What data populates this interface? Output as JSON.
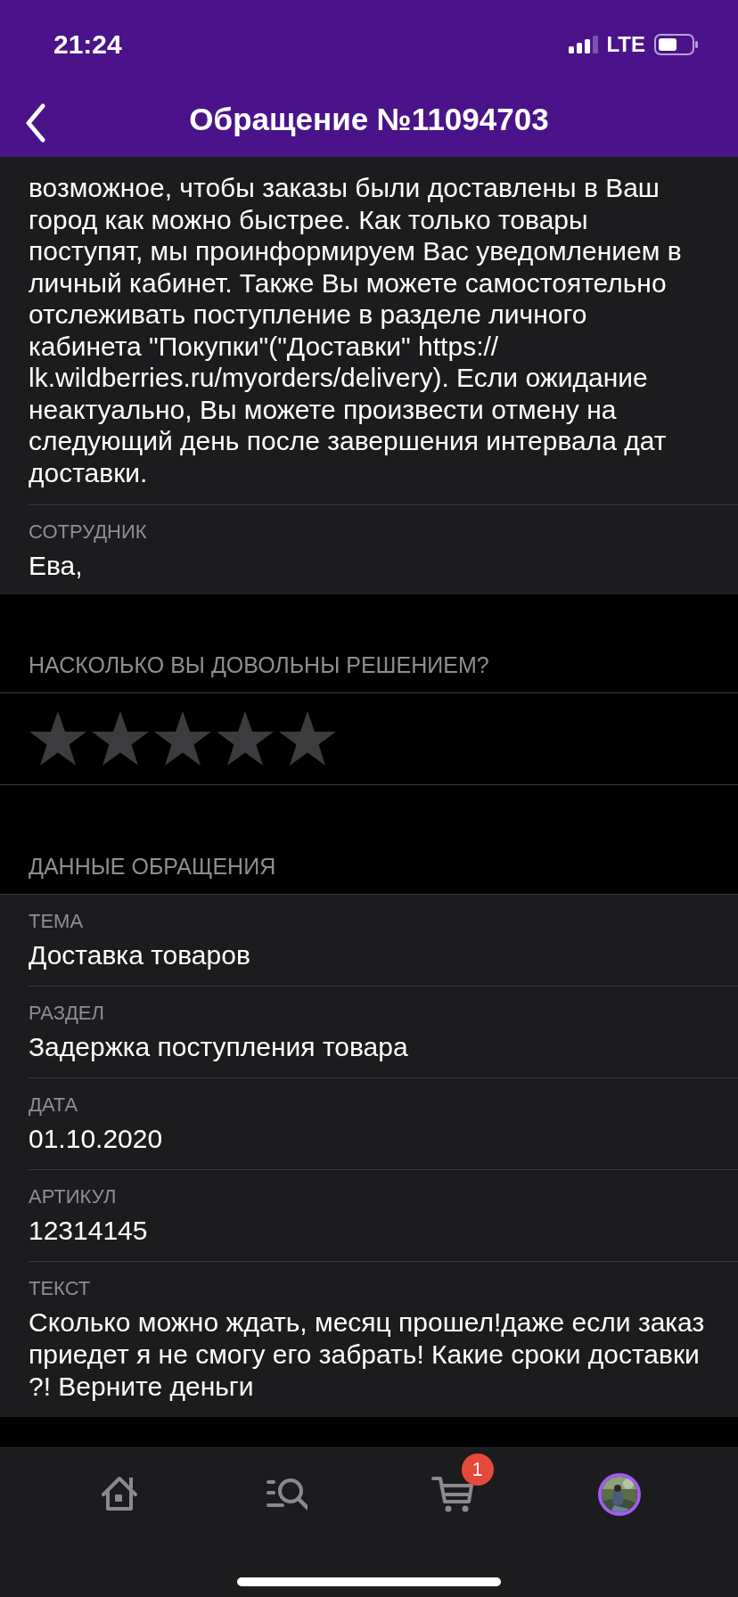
{
  "status_bar": {
    "time": "21:24",
    "network": "LTE"
  },
  "header": {
    "title": "Обращение №11094703"
  },
  "answer": {
    "lines": [
      "возможное, чтобы заказы были доставлены в Ваш",
      "город как можно быстрее. Как только товары",
      "поступят, мы проинформируем Вас уведомлением в",
      "личный кабинет. Также Вы можете самостоятельно",
      "отслеживать поступление в разделе личного",
      "кабинета \"Покупки\"(\"Доставки\" https://",
      "lk.wildberries.ru/myorders/delivery). Если ожидание",
      "неактуально, Вы можете произвести отмену на",
      "следующий день после завершения интервала дат",
      "доставки."
    ],
    "employee_label": "СОТРУДНИК",
    "employee": "Ева,"
  },
  "rating": {
    "question": "НАСКОЛЬКО ВЫ ДОВОЛЬНЫ РЕШЕНИЕМ?",
    "stars": 0
  },
  "details": {
    "title": "ДАННЫЕ ОБРАЩЕНИЯ",
    "fields": [
      {
        "label": "ТЕМА",
        "value": "Доставка товаров"
      },
      {
        "label": "РАЗДЕЛ",
        "value": "Задержка поступления товара"
      },
      {
        "label": "ДАТА",
        "value": "01.10.2020"
      },
      {
        "label": "АРТИКУЛ",
        "value": "12314145"
      },
      {
        "label": "ТЕКСТ",
        "value": "Сколько можно ждать, месяц прошел!даже если заказ приедет я не смогу его забрать! Какие сроки доставки ?! Верните деньги"
      }
    ]
  },
  "tab_bar": {
    "items": [
      {
        "kind": "home"
      },
      {
        "kind": "search"
      },
      {
        "kind": "cart",
        "badge": "1"
      },
      {
        "kind": "profile"
      }
    ]
  }
}
